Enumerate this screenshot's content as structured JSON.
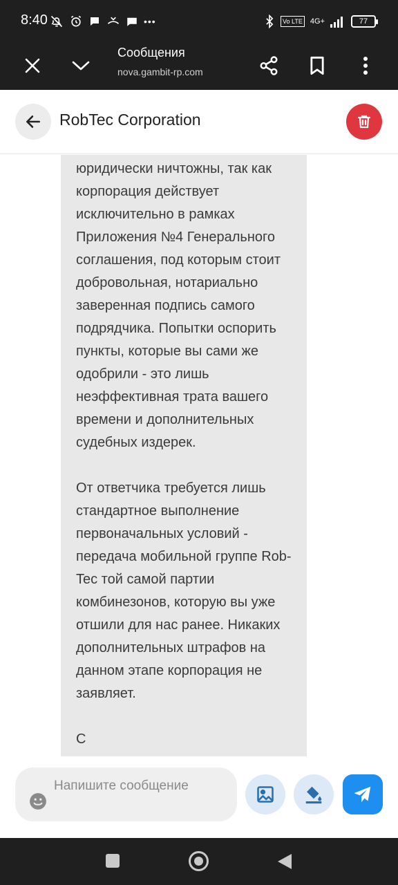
{
  "status_bar": {
    "time": "8:40",
    "network": "4G+",
    "battery": "77",
    "more": "•••"
  },
  "browser_bar": {
    "title": "Сообщения",
    "url": "nova.gambit-rp.com",
    "icons": [
      "close-icon",
      "chevron-down-icon",
      "share-icon",
      "bookmark-icon",
      "more-vertical-icon"
    ]
  },
  "chat": {
    "contact_name": "RobTec Corporation",
    "message_text": "юридически ничтожны, так как корпорация действует исключительно в рамках Приложения №4 Генерального соглашения, под которым стоит добровольная, нотариально заверенная подпись самого подрядчика. Попытки оспорить пункты, которые вы сами же одобрили - это лишь неэффективная трата вашего времени и дополнительных судебных издерек.\n\nОт ответчика требуется лишь стандартное выполнение первоначальных условий - передача мобильной группе Rob-Tec той самой партии комбинезонов, которую вы уже отшили для нас ранее. Никаких дополнительных штрафов на данном этапе корпорация не заявляет.\n\nС"
  },
  "composer": {
    "placeholder": "Напишите сообщение"
  },
  "colors": {
    "dark_bar": "#1f1f1f",
    "bubble": "#e8e8e8",
    "delete": "#e0363f",
    "send": "#1d8ff0",
    "action_bg": "#dde9f6",
    "action_icon": "#2a6fb0"
  }
}
